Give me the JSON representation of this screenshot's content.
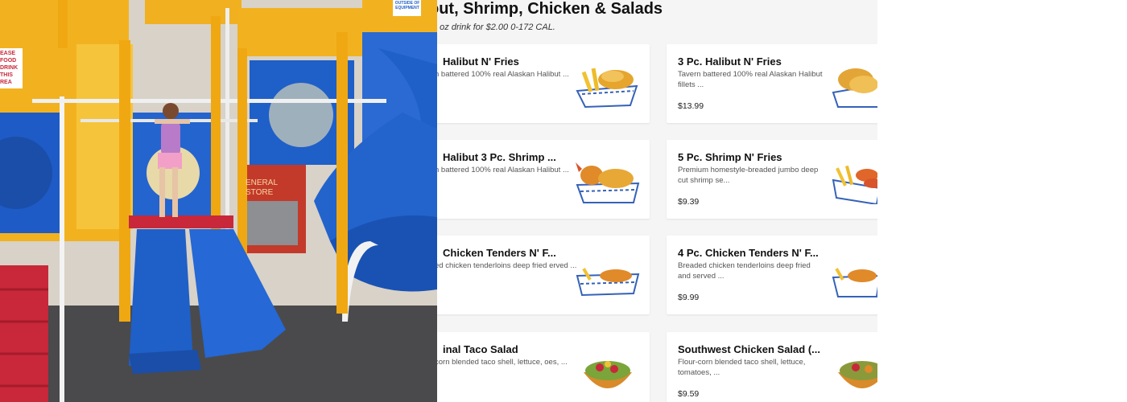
{
  "menu": {
    "title": "out, Shrimp, Chicken & Salads",
    "subtitle": "0 oz drink for $2.00 0-172 CAL."
  },
  "items": [
    {
      "name": "Halibut N' Fries",
      "desc": "n battered 100% real Alaskan Halibut ...",
      "price": "9"
    },
    {
      "name": "3 Pc. Halibut N' Fries",
      "desc": "Tavern battered 100% real Alaskan Halibut fillets ...",
      "price": "$13.99"
    },
    {
      "name": "Halibut 3 Pc. Shrimp ...",
      "desc": "n battered 100% real Alaskan Halibut ...",
      "price": "9"
    },
    {
      "name": "5 Pc. Shrimp N' Fries",
      "desc": "Premium homestyle-breaded jumbo deep cut shrimp se...",
      "price": "$9.39"
    },
    {
      "name": "Chicken Tenders N' F...",
      "desc": "ed chicken tenderloins deep fried erved ...",
      "price": ""
    },
    {
      "name": "4 Pc. Chicken Tenders N' F...",
      "desc": "Breaded chicken tenderloins deep fried and served ...",
      "price": "$9.99"
    },
    {
      "name": "inal Taco Salad",
      "desc": "corn blended taco shell, lettuce, oes, ...",
      "price": ""
    },
    {
      "name": "Southwest Chicken Salad (...",
      "desc": "Flour-corn blended taco shell, lettuce, tomatoes, ...",
      "price": "$9.59"
    }
  ],
  "photo": {
    "sign_please": "EASE FOOD DRINK THIS REA",
    "sign_equipment": "OUTSIDE OF EQUIPMENT",
    "sign_store": "ENERAL STORE"
  },
  "colors": {
    "accent_blue": "#1f5fc8",
    "accent_yellow": "#f3b41d",
    "accent_red": "#c8283a"
  }
}
